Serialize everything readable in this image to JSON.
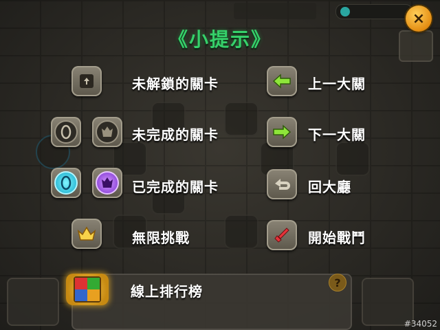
{
  "title": "《小提示》",
  "close_icon": "×",
  "help_icon": "?",
  "legend_left": [
    {
      "label": "未解鎖的關卡",
      "icon": "locked-stage-icon"
    },
    {
      "label": "未完成的關卡",
      "icon": "incomplete-stage-icon"
    },
    {
      "label": "已完成的關卡",
      "icon": "completed-stage-icon"
    },
    {
      "label": "無限挑戰",
      "icon": "crown-icon"
    }
  ],
  "legend_right": [
    {
      "label": "上一大關",
      "icon": "arrow-left-icon"
    },
    {
      "label": "下一大關",
      "icon": "arrow-right-icon"
    },
    {
      "label": "回大廳",
      "icon": "return-icon"
    },
    {
      "label": "開始戰鬥",
      "icon": "battle-icon"
    }
  ],
  "ranking": {
    "label": "線上排行榜",
    "icon": "leaderboard-icon"
  },
  "watermark": "#34052",
  "colors": {
    "title": "#36d06a",
    "close": "#f0a020"
  }
}
